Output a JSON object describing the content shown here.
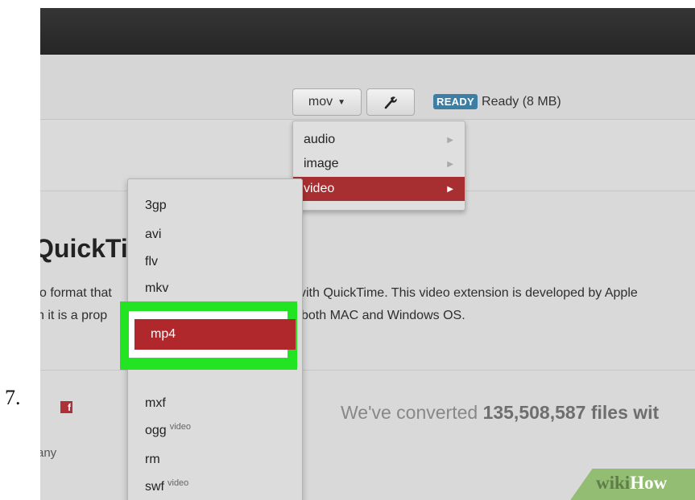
{
  "step_number": "7.",
  "toolbar": {
    "format_button": "mov",
    "wrench_icon": "wrench-icon",
    "status_badge": "READY",
    "status_text": "Ready (8 MB)"
  },
  "menu_primary": {
    "items": [
      {
        "label": "audio"
      },
      {
        "label": "image"
      },
      {
        "label": "video"
      }
    ],
    "active": "video"
  },
  "menu_secondary": {
    "items": [
      {
        "label": "3gp",
        "tag": ""
      },
      {
        "label": "avi",
        "tag": ""
      },
      {
        "label": "flv",
        "tag": ""
      },
      {
        "label": "mkv",
        "tag": ""
      },
      {
        "label": "mp4",
        "tag": ""
      },
      {
        "label": "mxf",
        "tag": ""
      },
      {
        "label": "ogg",
        "tag": "video"
      },
      {
        "label": "rm",
        "tag": ""
      },
      {
        "label": "swf",
        "tag": "video"
      }
    ],
    "highlighted": "mp4"
  },
  "content": {
    "heading": "QuickTi",
    "line1_left": "o format that",
    "line2_left": "h it is a prop",
    "line1_right": "vith QuickTime. This video extension is developed by Apple",
    "line2_right": "both MAC and Windows OS."
  },
  "footer": {
    "company": "any",
    "converted_prefix": "We've converted",
    "converted_count": "135,508,587 files",
    "converted_suffix": "wit"
  },
  "watermark": {
    "wiki": "wiki",
    "how": "How"
  },
  "colors": {
    "accent_red": "#a72f31",
    "badge_blue": "#3b7ea6",
    "highlight_green": "#22e422"
  }
}
